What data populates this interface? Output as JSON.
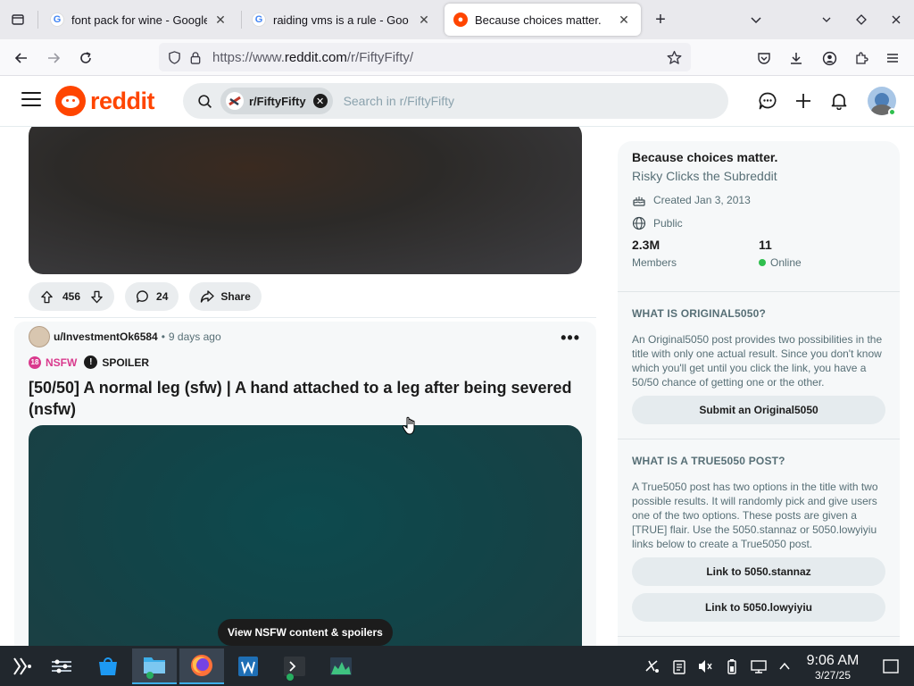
{
  "browser": {
    "tabs": [
      {
        "title": "font pack for wine - Google",
        "favicon": "google-icon",
        "active": false
      },
      {
        "title": "raiding vms is a rule - Goo",
        "favicon": "google-icon",
        "active": false
      },
      {
        "title": "Because choices matter.",
        "favicon": "reddit-icon",
        "active": true
      }
    ],
    "url_prefix": "https://www.",
    "url_domain": "reddit.com",
    "url_path": "/r/FiftyFifty/"
  },
  "reddit": {
    "logo_text": "reddit",
    "search": {
      "community_chip": "r/FiftyFifty",
      "placeholder": "Search in r/FiftyFifty"
    }
  },
  "feed": {
    "post1_actions": {
      "upvotes": "456",
      "comments": "24",
      "share": "Share"
    },
    "post2": {
      "author": "u/InvestmentOk6584",
      "separator": "•",
      "time": "9 days ago",
      "nsfw_label": "NSFW",
      "spoiler_label": "SPOILER",
      "title": "[50/50] A normal leg (sfw) | A hand attached to a leg after being severed (nsfw)"
    },
    "nsfw_button": "View NSFW content & spoilers"
  },
  "sidebar": {
    "title": "Because choices matter.",
    "subtitle": "Risky Clicks the Subreddit",
    "created": "Created Jan 3, 2013",
    "visibility": "Public",
    "members_count": "2.3M",
    "members_label": "Members",
    "online_count": "11",
    "online_label": "Online",
    "original_heading": "WHAT IS ORIGINAL5050?",
    "original_body": "An Original5050 post provides two possibilities in the title with only one actual result. Since you don't know which you'll get until you click the link, you have a 50/50 chance of getting one or the other.",
    "original_button": "Submit an Original5050",
    "true_heading": "WHAT IS A TRUE5050 POST?",
    "true_body": "A True5050 post has two options in the title with two possible results. It will randomly pick and give users one of the two options. These posts are given a [TRUE] flair. Use the 5050.stannaz or 5050.lowyiyiu links below to create a True5050 post.",
    "link1": "Link to 5050.stannaz",
    "link2": "Link to 5050.lowyiyiu"
  },
  "taskbar": {
    "time": "9:06 AM",
    "date": "3/27/25"
  },
  "colors": {
    "reddit_orange": "#ff4500",
    "nsfw_pink": "#d93a8d",
    "online_green": "#2fbf4e",
    "taskbar_bg": "#21272d"
  }
}
